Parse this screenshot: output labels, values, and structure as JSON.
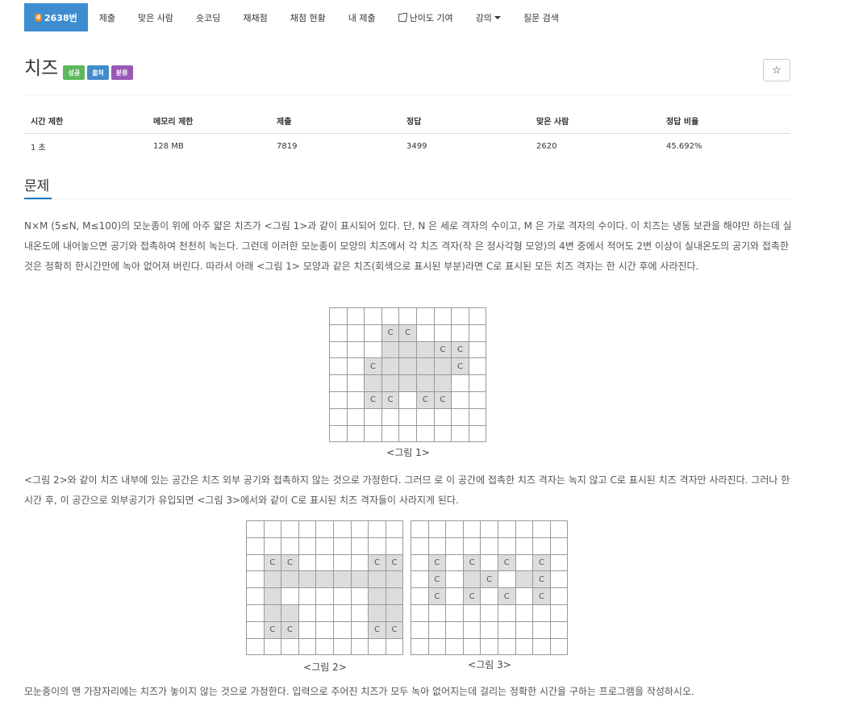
{
  "nav": {
    "problem_badge": "4",
    "problem_number": "2638번",
    "items": [
      "제출",
      "맞은 사람",
      "숏코딩",
      "재채점",
      "채점 현황",
      "내 제출",
      "난이도 기여",
      "강의",
      "질문 검색"
    ]
  },
  "title": "치즈",
  "labels": [
    "성공",
    "출처",
    "분류"
  ],
  "star": "☆",
  "stats": {
    "headers": [
      "시간 제한",
      "메모리 제한",
      "제출",
      "정답",
      "맞은 사람",
      "정답 비율"
    ],
    "values": [
      "1 초",
      "128 MB",
      "7819",
      "3499",
      "2620",
      "45.692%"
    ]
  },
  "section_title": "문제",
  "paragraphs": [
    "N×M (5≤N, M≤100)의 모눈종이 위에 아주 얇은 치즈가 <그림 1>과 같이 표시되어 있다. 단, N 은 세로 격자의 수이고, M 은 가로 격자의 수이다. 이 치즈는 냉동 보관을 해야만 하는데 실내온도에 내어놓으면 공기와 접촉하여 천천히 녹는다. 그런데 이러한 모눈종이 모양의 치즈에서 각 치즈 격자(작 은 정사각형 모양)의 4변 중에서 적어도 2변 이상이 실내온도의 공기와 접촉한 것은 정확히 한시간만에 녹아 없어져 버린다. 따라서 아래 <그림 1> 모양과 같은 치즈(회색으로 표시된 부분)라면 C로 표시된 모든 치즈 격자는 한 시간 후에 사라진다.",
    "<그림 2>와 같이 치즈 내부에 있는 공간은 치즈 외부 공기와 접촉하지 않는 것으로 가정한다. 그러므 로 이 공간에 접촉한 치즈 격자는 녹지 않고 C로 표시된 치즈 격자만 사라진다. 그러나 한 시간 후, 이 공간으로 외부공기가 유입되면 <그림 3>에서와 같이 C로 표시된 치즈 격자들이 사라지게 된다.",
    "모눈종이의 맨 가장자리에는 치즈가 놓이지 않는 것으로 가정한다. 입력으로 주어진 치즈가 모두 녹아 없어지는데 걸리는 정확한 시간을 구하는 프로그램을 작성하시오."
  ],
  "figures": [
    {
      "caption": "<그림 1>",
      "rows": [
        ".........",
        "...CC....",
        "...GGGCC.",
        "..CGGGGC.",
        "..GGGGG..",
        "..CC.CC..",
        ".........",
        "........."
      ]
    },
    {
      "caption": "<그림 2>",
      "rows": [
        ".........",
        "...........",
        ".CC....CC.",
        ".GGGGGGGG.",
        ".G.....GG.",
        ".GG....GG.",
        ".CC....CC.",
        "........."
      ]
    },
    {
      "caption": "<그림 3>",
      "rows": [
        ".........",
        ".........",
        ".C.C.C.C.",
        ".C.GC.GC.",
        ".C.C.C.C.",
        ".........",
        ".........",
        "........."
      ]
    }
  ]
}
